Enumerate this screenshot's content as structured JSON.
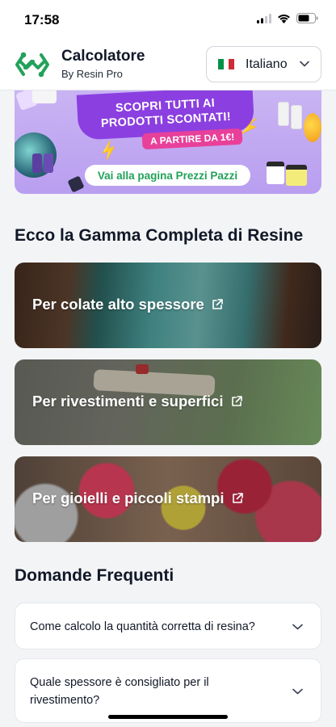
{
  "status_bar": {
    "time": "17:58"
  },
  "header": {
    "title": "Calcolatore",
    "subtitle": "By Resin Pro",
    "language": {
      "label": "Italiano",
      "flag_colors": [
        "#009246",
        "#ffffff",
        "#ce2b37"
      ]
    }
  },
  "promo": {
    "line1": "SCOPRI TUTTI AI",
    "line2": "PRODOTTI SCONTATI!",
    "price_tag": "A PARTIRE DA 1€!",
    "button_label": "Vai alla pagina Prezzi Pazzi"
  },
  "range_section": {
    "title": "Ecco la Gamma Completa di Resine",
    "categories": [
      {
        "label": "Per colate alto spessore",
        "icon": "external-link-icon"
      },
      {
        "label": "Per rivestimenti e superfici",
        "icon": "external-link-icon"
      },
      {
        "label": "Per gioielli e piccoli stampi",
        "icon": "external-link-icon"
      }
    ]
  },
  "faq": {
    "title": "Domande Frequenti",
    "items": [
      {
        "question": "Come calcolo la quantità corretta di resina?"
      },
      {
        "question_line1": "Quale spessore è consigliato per il",
        "question_line2": "rivestimento?"
      }
    ]
  },
  "colors": {
    "brand_green": "#22a15a",
    "promo_purple": "#8b3fe0",
    "promo_pink": "#e8409a"
  }
}
